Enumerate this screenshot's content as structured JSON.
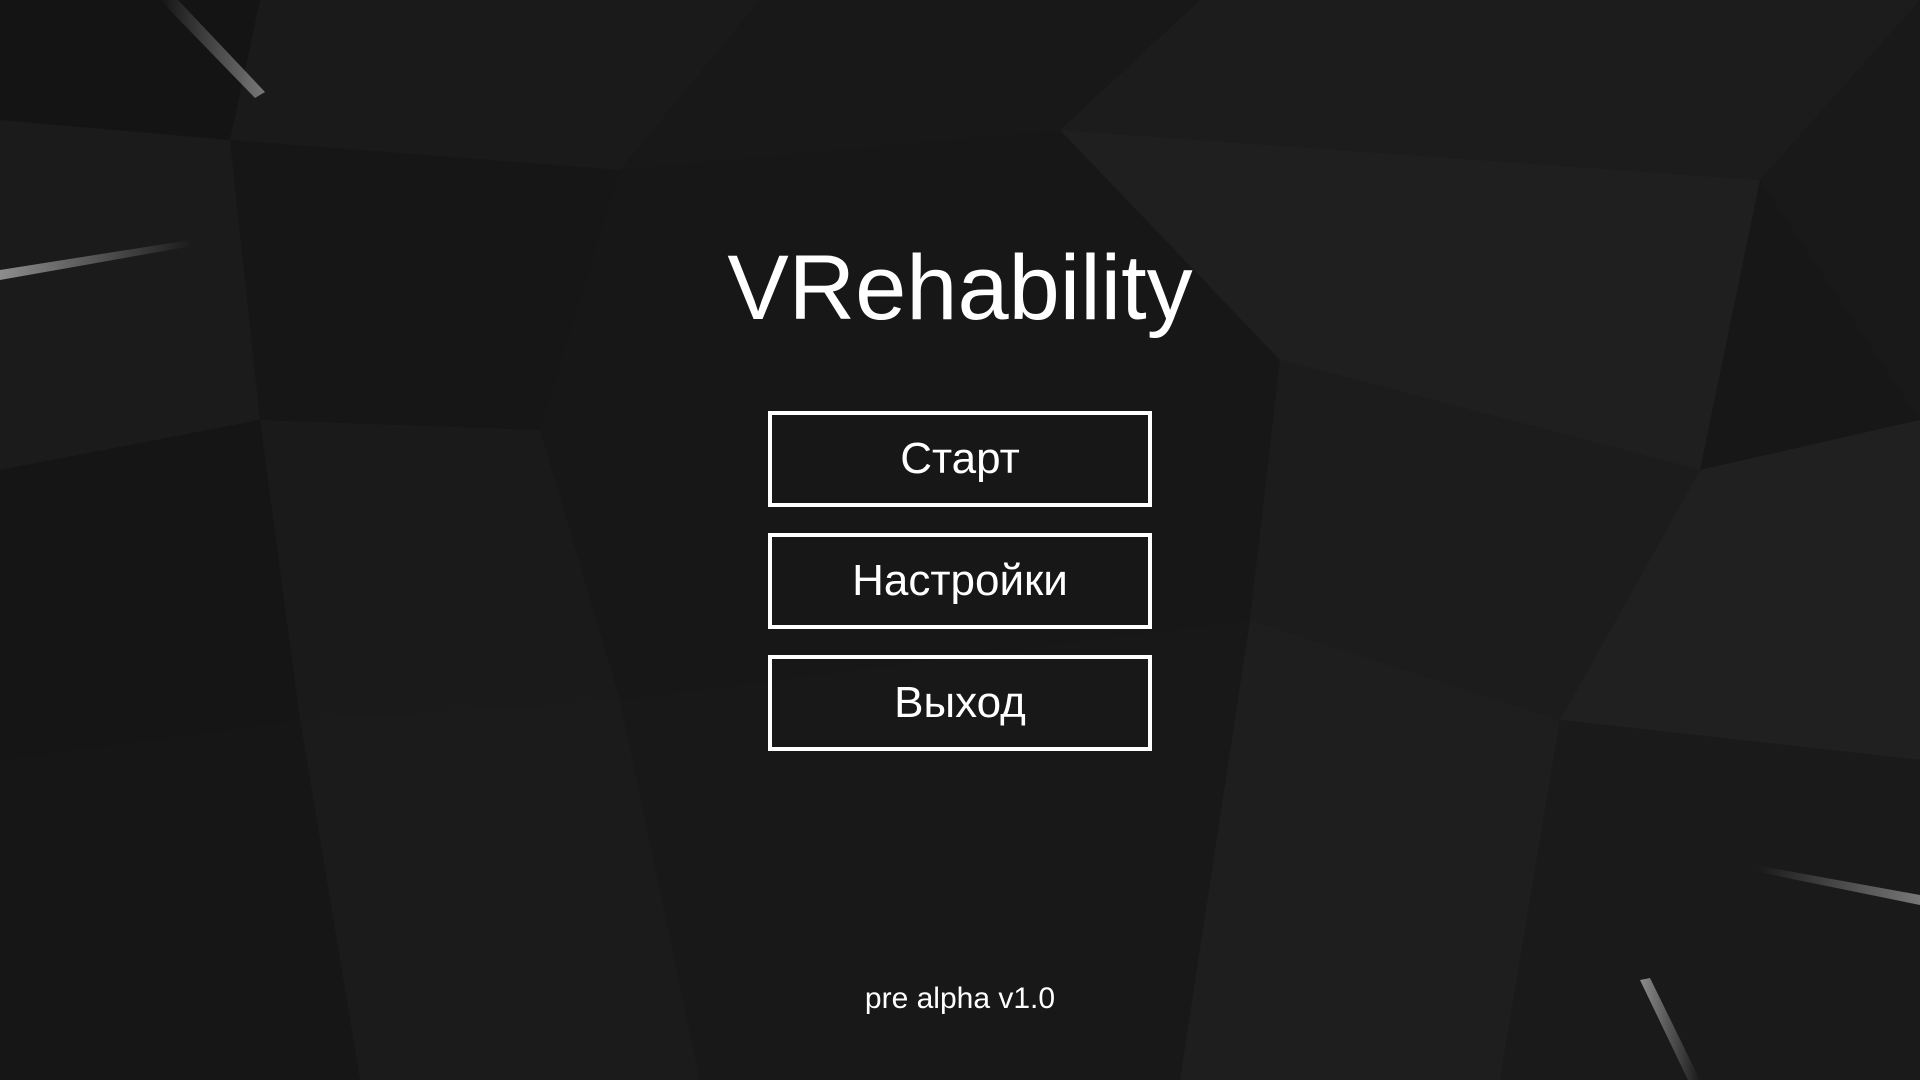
{
  "app": {
    "title": "VRehability",
    "version": "pre alpha v1.0"
  },
  "menu": {
    "items": [
      {
        "label": "Старт"
      },
      {
        "label": "Настройки"
      },
      {
        "label": "Выход"
      }
    ]
  },
  "theme": {
    "background": "#171717",
    "foreground": "#ffffff",
    "accent_streak": "#8a8a8a"
  }
}
